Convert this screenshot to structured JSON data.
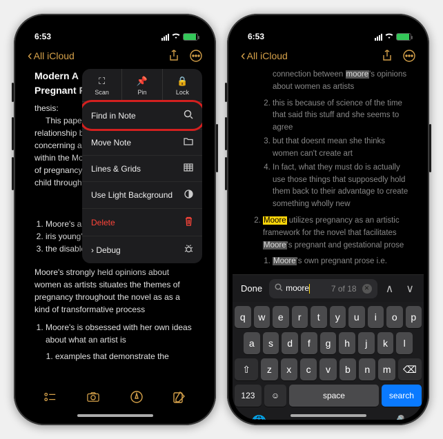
{
  "status": {
    "time": "6:53",
    "ampm_dots": "⠇"
  },
  "nav": {
    "back": "All iCloud",
    "chevron": "‹"
  },
  "left": {
    "title_l1": "Modern A",
    "title_l2": "Pregnant P",
    "thesis_label": "thesis:",
    "intro": "This paper",
    "p1": "relationship b",
    "p2": "concerning a",
    "p3": "within the Mo",
    "p4": "of pregnancy",
    "p5": "child througho",
    "ol1": [
      "Moore's art and artistry +",
      "iris young's pregnancy =",
      "the disabled child as art"
    ],
    "para2": "Moore's strongly held opinions about women as artists situates the themes of pregnancy throughout the novel as as a kind of transformative process",
    "ol2_1": "Moore's is obsessed with her own ideas about what an artist is",
    "ol2_1_1": "examples that demonstrate the"
  },
  "sheet": {
    "scan": "Scan",
    "pin": "Pin",
    "lock": "Lock",
    "find": "Find in Note",
    "move": "Move Note",
    "lines": "Lines & Grids",
    "light": "Use Light Background",
    "delete": "Delete",
    "debug": "Debug"
  },
  "right": {
    "li1_a": "connection between ",
    "li1_hl": "moore",
    "li1_b": "'s opinions about women as artists",
    "li2": "this is because of science of the time that said this stuff and she seems to agree",
    "li3": "but that doesnt mean she thinks women can't create art",
    "li4": "In fact, what they must do is actually use those things that supposedly hold them back to their advantage to create something wholly new",
    "li5_hl": "Moore",
    "li5_a": " utilizes pregnancy as an artistic framework for the novel that facilitates ",
    "li5_hl2": "Moore",
    "li5_b": "'s pregnant and gestational prose",
    "li6_hl": "Moore",
    "li6_a": "'s own pregnant prose i.e."
  },
  "find": {
    "done": "Done",
    "query": "moore",
    "counter": "7 of 18"
  },
  "kbd": {
    "r1": [
      "q",
      "w",
      "e",
      "r",
      "t",
      "y",
      "u",
      "i",
      "o",
      "p"
    ],
    "r2": [
      "a",
      "s",
      "d",
      "f",
      "g",
      "h",
      "j",
      "k",
      "l"
    ],
    "r3": [
      "z",
      "x",
      "c",
      "v",
      "b",
      "n",
      "m"
    ],
    "shift": "⇧",
    "bksp": "⌫",
    "num": "123",
    "emoji": "☺",
    "space": "space",
    "search": "search",
    "globe": "🌐",
    "mic": "🎤"
  }
}
